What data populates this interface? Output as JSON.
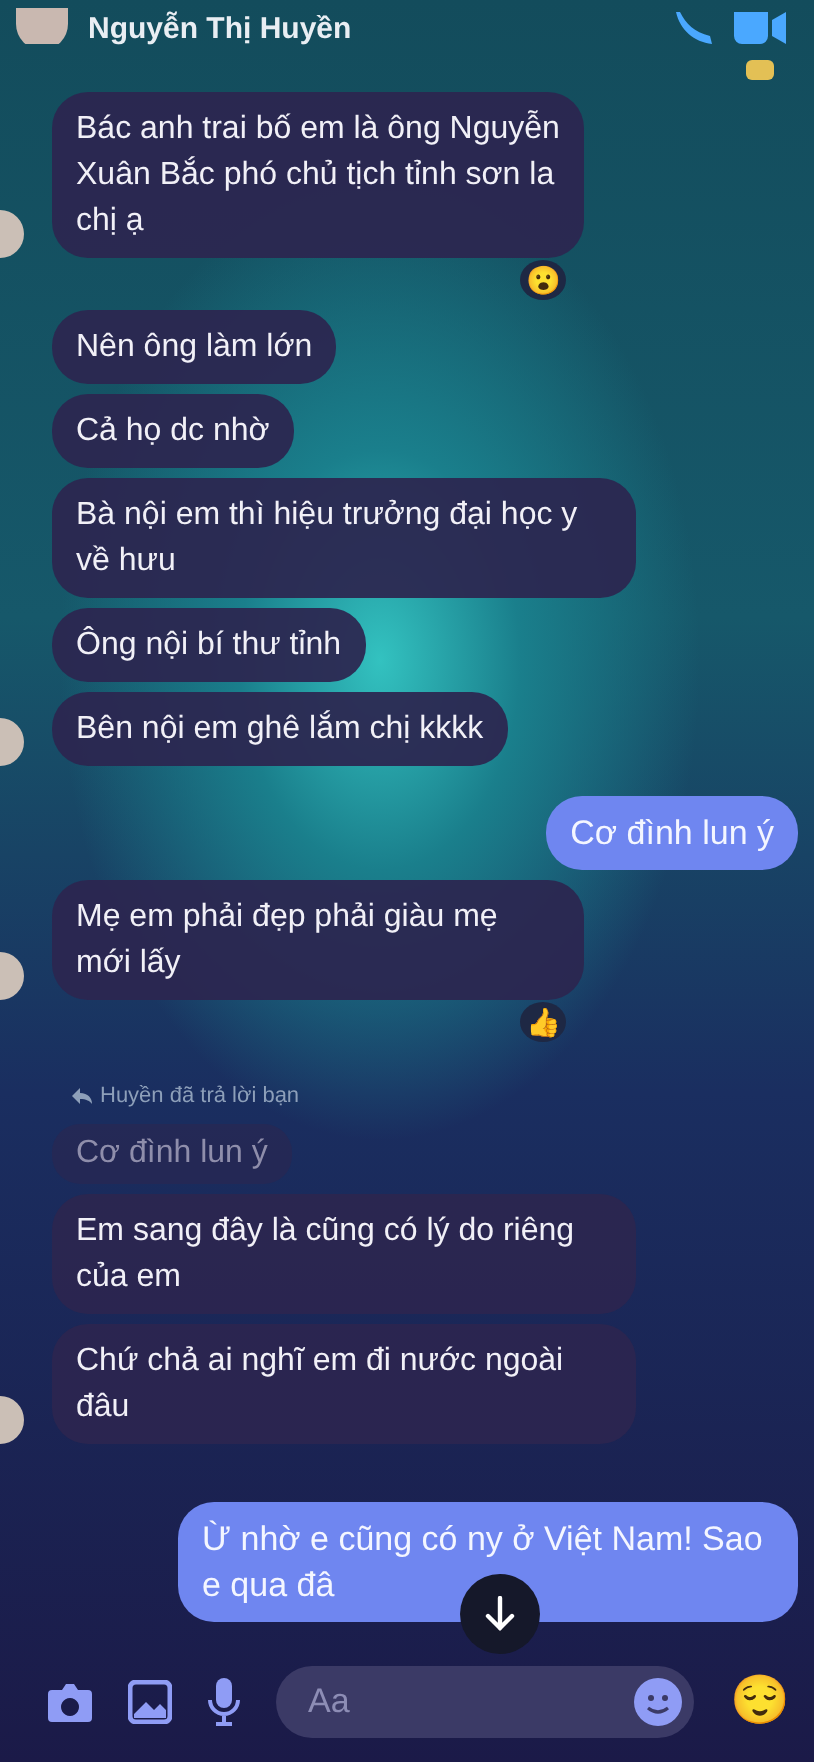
{
  "header": {
    "title": "Nguyễn Thị Huyền"
  },
  "messages": [
    {
      "kind": "incoming",
      "text": "Bác anh trai bố em là ông Nguyễn Xuân Bắc phó chủ tịch tỉnh sơn la chị ạ",
      "avatar": true,
      "reaction": "😮"
    },
    {
      "kind": "incoming",
      "text": "Nên ông làm lớn",
      "avatar": false
    },
    {
      "kind": "incoming",
      "text": "Cả họ dc nhờ",
      "avatar": false
    },
    {
      "kind": "incoming",
      "text": "Bà nội em thì hiệu trưởng đại học y về hưu",
      "avatar": false
    },
    {
      "kind": "incoming",
      "text": "Ông nội bí thư tỉnh",
      "avatar": false
    },
    {
      "kind": "incoming",
      "text": "Bên nội em ghê lắm chị kkkk",
      "avatar": true
    },
    {
      "kind": "outgoing",
      "text": "Cơ đình lun ý"
    },
    {
      "kind": "incoming",
      "text": "Mẹ em phải đẹp phải giàu mẹ mới lấy",
      "avatar": true,
      "reaction": "👍"
    },
    {
      "kind": "reply-label",
      "text": "Huyền đã trả lời bạn"
    },
    {
      "kind": "quote",
      "text": "Cơ đình lun ý"
    },
    {
      "kind": "incoming",
      "text": "Em sang đây là cũng có lý do riêng của em",
      "avatar": false
    },
    {
      "kind": "incoming",
      "text": "Chứ chả ai nghĩ em đi nước ngoài đâu",
      "avatar": true
    },
    {
      "kind": "outgoing",
      "text": "Ừ nhờ e cũng có ny ở Việt Nam! Sao e qua đâ"
    }
  ],
  "composer": {
    "placeholder": "Aa",
    "emoji": "😌"
  }
}
